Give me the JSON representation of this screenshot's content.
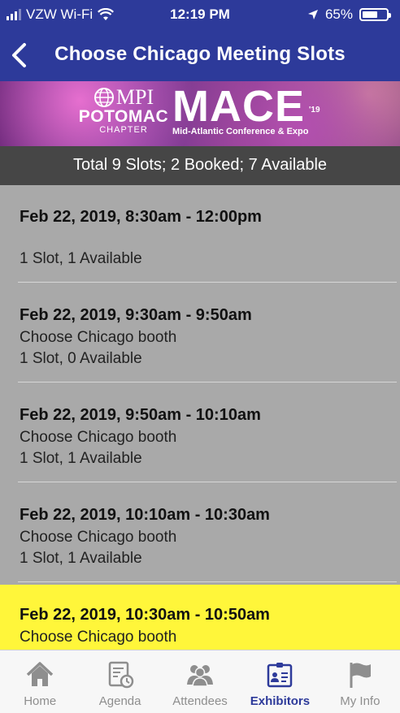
{
  "status_bar": {
    "carrier": "VZW Wi-Fi",
    "time": "12:19 PM",
    "battery_text": "65%",
    "battery_level": 0.65
  },
  "nav": {
    "title": "Choose Chicago Meeting Slots"
  },
  "banner": {
    "mpi": "MPI",
    "potomac": "POTOMAC",
    "chapter": "CHAPTER",
    "mace": "MACE",
    "year": "'19",
    "subtitle": "Mid-Atlantic Conference & Expo"
  },
  "summary": "Total 9 Slots; 2 Booked; 7 Available",
  "slots": [
    {
      "time": "Feb 22, 2019, 8:30am - 12:00pm",
      "booth": "",
      "availability": "1 Slot, 1 Available",
      "highlighted": false
    },
    {
      "time": "Feb 22, 2019, 9:30am - 9:50am",
      "booth": "Choose Chicago booth",
      "availability": "1 Slot, 0 Available",
      "highlighted": false
    },
    {
      "time": "Feb 22, 2019, 9:50am - 10:10am",
      "booth": "Choose Chicago booth",
      "availability": "1 Slot, 1 Available",
      "highlighted": false
    },
    {
      "time": "Feb 22, 2019, 10:10am - 10:30am",
      "booth": "Choose Chicago booth",
      "availability": "1 Slot, 1 Available",
      "highlighted": false
    },
    {
      "time": "Feb 22, 2019, 10:30am - 10:50am",
      "booth": "Choose Chicago booth",
      "availability": "",
      "highlighted": true
    }
  ],
  "tabs": [
    {
      "label": "Home",
      "icon": "home-icon",
      "active": false
    },
    {
      "label": "Agenda",
      "icon": "agenda-icon",
      "active": false
    },
    {
      "label": "Attendees",
      "icon": "attendees-icon",
      "active": false
    },
    {
      "label": "Exhibitors",
      "icon": "exhibitors-icon",
      "active": true
    },
    {
      "label": "My Info",
      "icon": "flag-icon",
      "active": false
    }
  ],
  "colors": {
    "nav_blue": "#2d3a9a",
    "highlight_yellow": "#fff63a",
    "list_gray": "#a9a9a9",
    "summary_gray": "#464646"
  }
}
